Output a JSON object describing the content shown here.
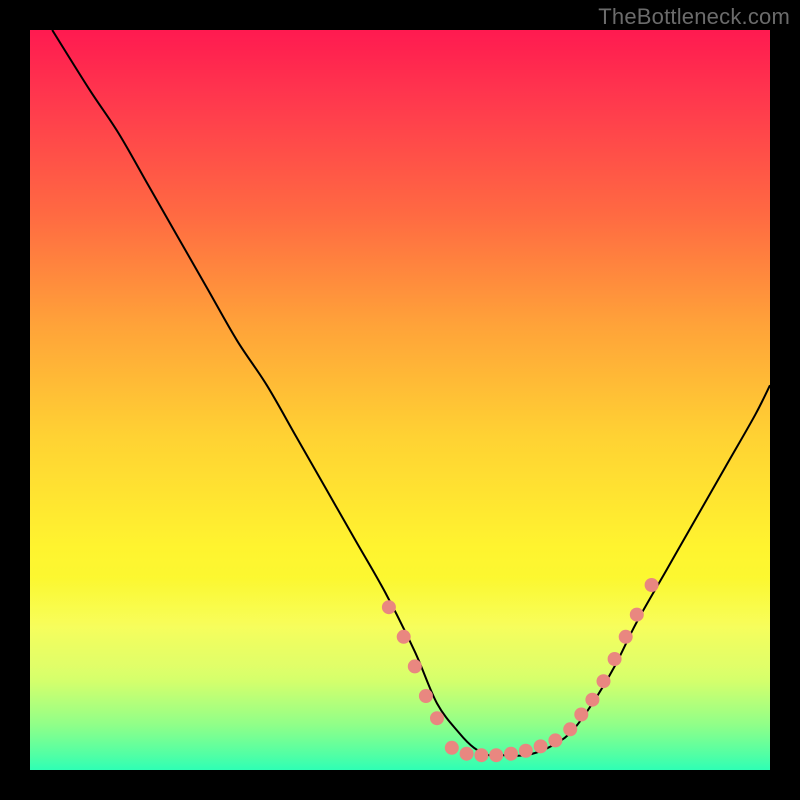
{
  "watermark": {
    "text": "TheBottleneck.com"
  },
  "chart_data": {
    "type": "line",
    "title": "",
    "xlabel": "",
    "ylabel": "",
    "xlim": [
      0,
      100
    ],
    "ylim": [
      0,
      100
    ],
    "grid": false,
    "legend": false,
    "series": [
      {
        "name": "curve",
        "x": [
          3,
          8,
          12,
          16,
          20,
          24,
          28,
          32,
          36,
          40,
          44,
          48,
          52,
          55,
          58,
          60,
          62,
          64,
          67,
          70,
          73,
          76,
          79,
          82,
          86,
          90,
          94,
          98,
          100
        ],
        "y": [
          100,
          92,
          86,
          79,
          72,
          65,
          58,
          52,
          45,
          38,
          31,
          24,
          16,
          9,
          5,
          3,
          2,
          2,
          2,
          3,
          5,
          9,
          14,
          20,
          27,
          34,
          41,
          48,
          52
        ],
        "stroke": "#000000",
        "stroke_width": 2
      }
    ],
    "markers": [
      {
        "name": "dots-descending",
        "x": [
          48.5,
          50.5,
          52.0,
          53.5,
          55.0
        ],
        "y": [
          22,
          18,
          14,
          10,
          7
        ],
        "r": 7,
        "fill": "#e98780"
      },
      {
        "name": "dots-trough",
        "x": [
          57,
          59,
          61,
          63,
          65,
          67,
          69,
          71
        ],
        "y": [
          3,
          2.2,
          2,
          2,
          2.2,
          2.6,
          3.2,
          4
        ],
        "r": 7,
        "fill": "#e98780"
      },
      {
        "name": "dots-ascending",
        "x": [
          73,
          74.5,
          76,
          77.5,
          79,
          80.5,
          82,
          84
        ],
        "y": [
          5.5,
          7.5,
          9.5,
          12,
          15,
          18,
          21,
          25
        ],
        "r": 7,
        "fill": "#e98780"
      }
    ],
    "background_gradient": {
      "direction": "vertical",
      "stops": [
        {
          "pos": 0.0,
          "color": "#ff1a50"
        },
        {
          "pos": 0.1,
          "color": "#ff3a4d"
        },
        {
          "pos": 0.25,
          "color": "#ff6a42"
        },
        {
          "pos": 0.4,
          "color": "#ffa339"
        },
        {
          "pos": 0.55,
          "color": "#ffd233"
        },
        {
          "pos": 0.7,
          "color": "#fff42f"
        },
        {
          "pos": 0.8,
          "color": "#f6fd33"
        },
        {
          "pos": 0.88,
          "color": "#d6ff45"
        },
        {
          "pos": 0.94,
          "color": "#8cff74"
        },
        {
          "pos": 1.0,
          "color": "#2bffb0"
        }
      ]
    }
  }
}
